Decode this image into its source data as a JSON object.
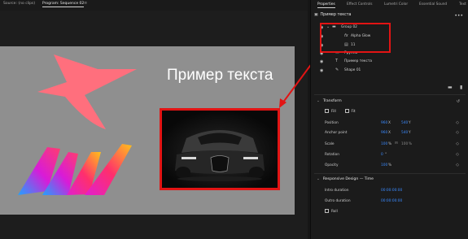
{
  "monitor": {
    "tab_source": "Source: (no clips)",
    "tab_program": "Program: Sequence 02",
    "tab_menu": "≡",
    "canvas_title": "Пример текста"
  },
  "properties_panel": {
    "tabs": [
      "Properties",
      "Effect Controls",
      "Lumetri Color",
      "Essential Sound",
      "Text"
    ],
    "header": "Пример текста",
    "more": "•••",
    "layers": [
      {
        "label": "Group 02",
        "icon": "folder-icon",
        "visible": true
      },
      {
        "label": "Alpha Glow",
        "icon": "fx-icon",
        "visible": true
      },
      {
        "label": "11",
        "icon": "image-icon",
        "visible": true
      },
      {
        "label": "Группа",
        "icon": "group-icon",
        "visible": true
      },
      {
        "label": "Пример текста",
        "icon": "text-icon",
        "visible": true
      },
      {
        "label": "Shape 01",
        "icon": "pen-icon",
        "visible": true
      }
    ],
    "transform": {
      "title": "Transform",
      "fill_label": "Fill",
      "fit_label": "Fit",
      "rows": [
        {
          "label": "Position",
          "v1": "960",
          "u1": "X",
          "v2": "540",
          "u2": "Y"
        },
        {
          "label": "Anchor point",
          "v1": "960",
          "u1": "X",
          "v2": "540",
          "u2": "Y"
        },
        {
          "label": "Scale",
          "v1": "100",
          "u1": "%",
          "v2": "100",
          "u2": "%"
        },
        {
          "label": "Rotation",
          "v1": "0",
          "u1": "°",
          "v2": "",
          "u2": ""
        },
        {
          "label": "Opacity",
          "v1": "100",
          "u1": "%",
          "v2": "",
          "u2": ""
        }
      ]
    },
    "responsive": {
      "title": "Responsive Design — Time",
      "rows": [
        {
          "label": "Intro duration",
          "value": "00:00:00:00"
        },
        {
          "label": "Outro duration",
          "value": "00:00:00:00"
        }
      ],
      "roll_label": "Roll"
    }
  },
  "colors": {
    "annotation_red": "#e21414",
    "value_blue": "#3b8bff",
    "canvas_gray": "#8f8f8f"
  }
}
